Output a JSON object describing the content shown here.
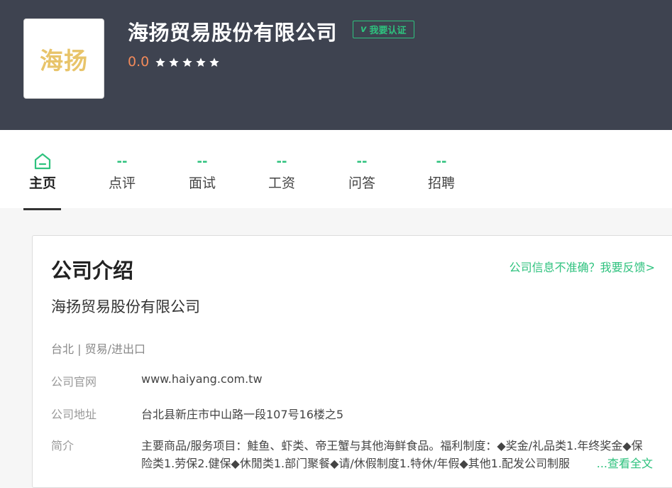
{
  "colors": {
    "header_bg": "#3e4350",
    "accent_green": "#2ec27e",
    "rating_orange": "#f28a5a",
    "logo_gold": "#e8c46a",
    "star_white": "#ffffff"
  },
  "header": {
    "logo_text": "海扬",
    "company_name": "海扬贸易股份有限公司",
    "verify_badge": {
      "prefix": "v",
      "label": "我要认证"
    },
    "rating": "0.0",
    "stars": {
      "count": 5,
      "filled": 0
    }
  },
  "tabs": [
    {
      "id": "home",
      "count": "",
      "label": "主页",
      "icon": "home-icon",
      "active": true
    },
    {
      "id": "reviews",
      "count": "--",
      "label": "点评"
    },
    {
      "id": "interviews",
      "count": "--",
      "label": "面试"
    },
    {
      "id": "salary",
      "count": "--",
      "label": "工资"
    },
    {
      "id": "qa",
      "count": "--",
      "label": "问答"
    },
    {
      "id": "jobs",
      "count": "--",
      "label": "招聘"
    }
  ],
  "intro": {
    "title": "公司介绍",
    "feedback_link": "公司信息不准确？我要反馈>",
    "name": "海扬贸易股份有限公司",
    "tags": "台北 | 贸易/进出口",
    "website_label": "公司官网",
    "website": "www.haiyang.com.tw",
    "address_label": "公司地址",
    "address": "台北县新庄市中山路一段107号16楼之5",
    "summary_label": "简介",
    "summary": "主要商品/服务项目：鮭鱼、虾类、帝王蟹与其他海鲜食品。福利制度：◆奖金/礼品类1.年终奖金◆保险类1.劳保2.健保◆休閒类1.部门聚餐◆请/休假制度1.特休/年假◆其他1.配发公司制服",
    "read_more": "...查看全文"
  }
}
